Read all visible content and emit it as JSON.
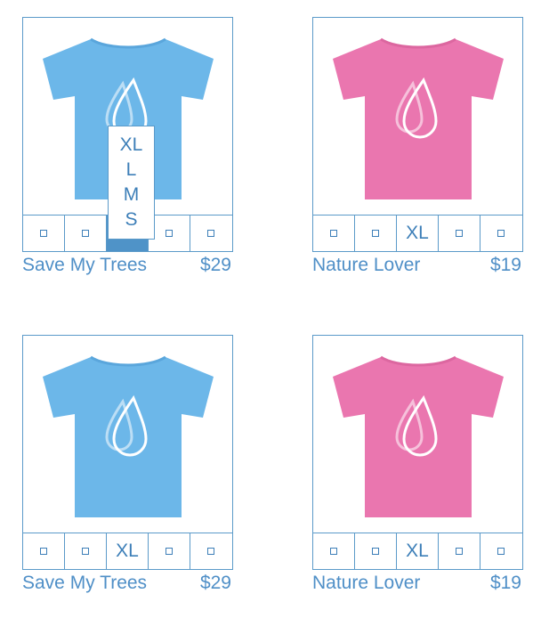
{
  "products": [
    {
      "name": "Save My Trees",
      "price": "$29",
      "shirt_color": "#6cb7e9",
      "sizes": [
        "square-icon",
        "square-icon",
        "XL",
        "square-icon",
        "square-icon"
      ],
      "selected_size": "XL",
      "dropdown_open": true,
      "dropdown_options": [
        "XL",
        "L",
        "M",
        "S"
      ]
    },
    {
      "name": "Nature Lover",
      "price": "$19",
      "shirt_color": "#ea76af",
      "sizes": [
        "square-icon",
        "square-icon",
        "XL",
        "square-icon",
        "square-icon"
      ]
    },
    {
      "name": "Save My Trees",
      "price": "$29",
      "shirt_color": "#6cb7e9",
      "sizes": [
        "square-icon",
        "square-icon",
        "XL",
        "square-icon",
        "square-icon"
      ]
    },
    {
      "name": "Nature Lover",
      "price": "$19",
      "shirt_color": "#ea76af",
      "sizes": [
        "square-icon",
        "square-icon",
        "XL",
        "square-icon",
        "square-icon"
      ]
    }
  ],
  "theme": {
    "accent": "#4f93c8",
    "border": "#5b9ac9"
  }
}
